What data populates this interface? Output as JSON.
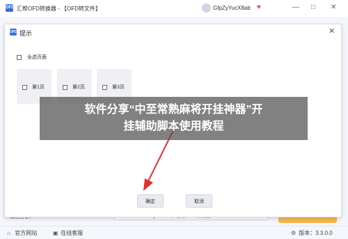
{
  "app": {
    "title": "汇帮OFD转换器 - 【OFD转文件】",
    "icon_text": "OFD",
    "user": "GfpZyYucX8ab",
    "controls": [
      "—",
      "□",
      "✕"
    ]
  },
  "background": {
    "output_dir_label": "输出目录：",
    "output_path": "C:\\Users\\huibang\\Desktop\\汇帮OFD转换器",
    "footer": {
      "website": "官方网站",
      "support": "在线客服",
      "version": "版本：3.3.0.0"
    }
  },
  "dialog": {
    "title": "提示",
    "select_all": "全选页面",
    "pages": [
      "第1页",
      "第2页",
      "第3页"
    ],
    "confirm": "确定",
    "cancel": "取消"
  },
  "watermark": {
    "line1": "软件分享“中至常熟麻将开挂神器”开",
    "line2": "挂辅助脚本使用教程"
  },
  "colors": {
    "accent": "#3a6fe0",
    "annotation_arrow": "#e03030",
    "convert_button": "#f7b84b"
  }
}
